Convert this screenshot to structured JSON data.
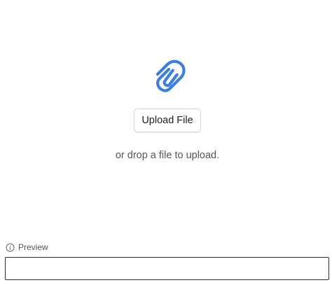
{
  "upload": {
    "icon": "paperclip-icon",
    "icon_color": "#3b7fe0",
    "button_label": "Upload File",
    "drop_hint": "or drop a file to upload."
  },
  "preview": {
    "icon": "info-icon",
    "label": "Preview",
    "value": ""
  }
}
